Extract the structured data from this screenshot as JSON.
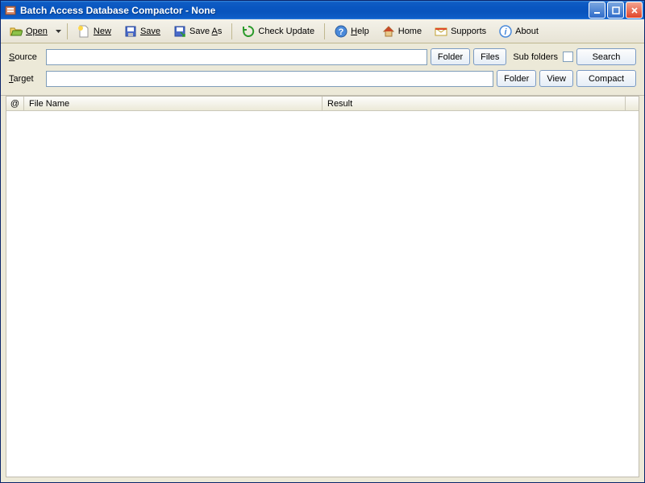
{
  "window": {
    "title": "Batch Access Database Compactor - None"
  },
  "toolbar": {
    "open": "Open",
    "new": "New",
    "save": "Save",
    "save_as": "Save As",
    "check_update": "Check Update",
    "help": "Help",
    "home": "Home",
    "supports": "Supports",
    "about": "About"
  },
  "form": {
    "source_label_pre": "S",
    "source_label_rest": "ource",
    "target_label_pre": "T",
    "target_label_rest": "arget",
    "source_value": "",
    "target_value": "",
    "folder": "Folder",
    "files": "Files",
    "view": "View",
    "sub_folders": "Sub folders",
    "search": "Search",
    "compact": "Compact"
  },
  "table": {
    "col_at": "@",
    "col_filename": "File Name",
    "col_result": "Result"
  }
}
